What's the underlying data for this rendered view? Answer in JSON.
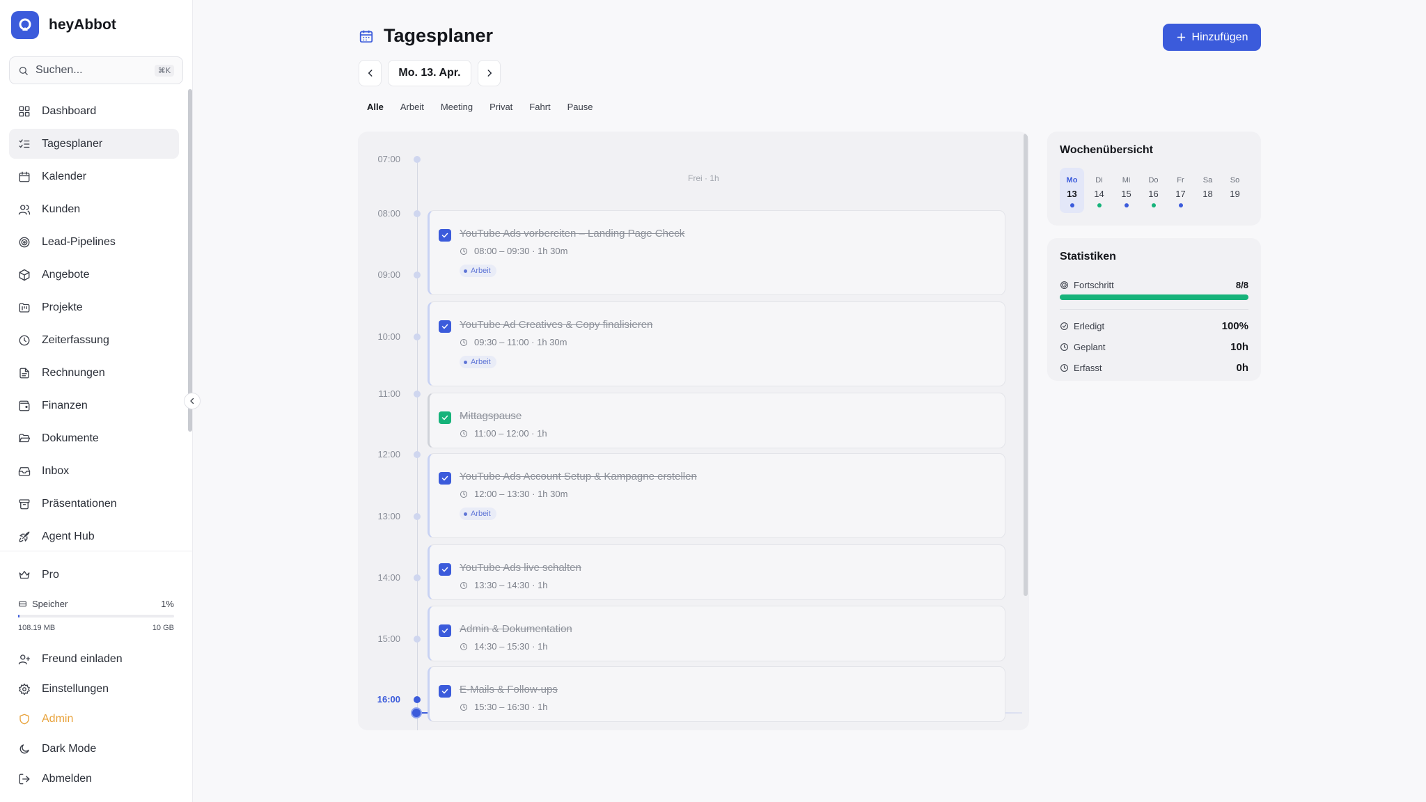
{
  "brand": {
    "name": "heyAbbot"
  },
  "search": {
    "placeholder": "Suchen...",
    "shortcut": "⌘K"
  },
  "nav": [
    {
      "id": "dashboard",
      "label": "Dashboard",
      "icon": "layout-grid-icon"
    },
    {
      "id": "tagesplaner",
      "label": "Tagesplaner",
      "icon": "list-checks-icon",
      "active": true
    },
    {
      "id": "kalender",
      "label": "Kalender",
      "icon": "calendar-icon"
    },
    {
      "id": "kunden",
      "label": "Kunden",
      "icon": "users-icon"
    },
    {
      "id": "lead-pipelines",
      "label": "Lead-Pipelines",
      "icon": "target-icon"
    },
    {
      "id": "angebote",
      "label": "Angebote",
      "icon": "package-icon"
    },
    {
      "id": "projekte",
      "label": "Projekte",
      "icon": "folder-kanban-icon"
    },
    {
      "id": "zeiterfassung",
      "label": "Zeiterfassung",
      "icon": "clock-icon"
    },
    {
      "id": "rechnungen",
      "label": "Rechnungen",
      "icon": "file-text-icon"
    },
    {
      "id": "finanzen",
      "label": "Finanzen",
      "icon": "wallet-icon"
    },
    {
      "id": "dokumente",
      "label": "Dokumente",
      "icon": "folder-open-icon"
    },
    {
      "id": "inbox",
      "label": "Inbox",
      "icon": "inbox-icon"
    },
    {
      "id": "praesentationen",
      "label": "Präsentationen",
      "icon": "archive-icon"
    },
    {
      "id": "agent-hub",
      "label": "Agent Hub",
      "icon": "rocket-icon"
    }
  ],
  "plan": {
    "label": "Pro",
    "icon": "crown-icon"
  },
  "storage": {
    "label": "Speicher",
    "percent_label": "1%",
    "fraction": 0.01,
    "used": "108.19 MB",
    "total": "10 GB"
  },
  "bottom_nav": [
    {
      "id": "freund-einladen",
      "label": "Freund einladen",
      "icon": "user-plus-icon"
    },
    {
      "id": "einstellungen",
      "label": "Einstellungen",
      "icon": "settings-icon"
    },
    {
      "id": "admin",
      "label": "Admin",
      "icon": "shield-icon",
      "accent": "#e8a23a"
    },
    {
      "id": "dark-mode",
      "label": "Dark Mode",
      "icon": "moon-icon"
    },
    {
      "id": "abmelden",
      "label": "Abmelden",
      "icon": "log-out-icon"
    }
  ],
  "header": {
    "title": "Tagesplaner",
    "add_label": "Hinzufügen",
    "date": "Mo. 13. Apr."
  },
  "filters": [
    "Alle",
    "Arbeit",
    "Meeting",
    "Privat",
    "Fahrt",
    "Pause"
  ],
  "active_filter": "Alle",
  "timeline": {
    "hours": [
      "07:00",
      "08:00",
      "09:00",
      "10:00",
      "11:00",
      "12:00",
      "13:00",
      "14:00",
      "15:00",
      "16:00"
    ],
    "current_hour": "16:00",
    "free_label": "Frei · 1h",
    "events": [
      {
        "title": "YouTube Ads vorbereiten – Landing Page Check",
        "time": "08:00 – 09:30 · 1h 30m",
        "tag": "Arbeit",
        "done": true,
        "kind": "work"
      },
      {
        "title": "YouTube Ad Creatives & Copy finalisieren",
        "time": "09:30 – 11:00 · 1h 30m",
        "tag": "Arbeit",
        "done": true,
        "kind": "work"
      },
      {
        "title": "Mittagspause",
        "time": "11:00 – 12:00 · 1h",
        "tag": null,
        "done": true,
        "kind": "pause"
      },
      {
        "title": "YouTube Ads Account Setup & Kampagne erstellen",
        "time": "12:00 – 13:30 · 1h 30m",
        "tag": "Arbeit",
        "done": true,
        "kind": "work"
      },
      {
        "title": "YouTube Ads live schalten",
        "time": "13:30 – 14:30 · 1h",
        "tag": null,
        "done": true,
        "kind": "work"
      },
      {
        "title": "Admin & Dokumentation",
        "time": "14:30 – 15:30 · 1h",
        "tag": null,
        "done": true,
        "kind": "work"
      },
      {
        "title": "E-Mails & Follow-ups",
        "time": "15:30 – 16:30 · 1h",
        "tag": null,
        "done": true,
        "kind": "work"
      }
    ]
  },
  "week": {
    "title": "Wochenübersicht",
    "days": [
      {
        "name": "Mo",
        "num": "13",
        "active": true,
        "dot": "#3b5bdb"
      },
      {
        "name": "Di",
        "num": "14",
        "active": false,
        "dot": "#16b37a"
      },
      {
        "name": "Mi",
        "num": "15",
        "active": false,
        "dot": "#3b5bdb"
      },
      {
        "name": "Do",
        "num": "16",
        "active": false,
        "dot": "#16b37a"
      },
      {
        "name": "Fr",
        "num": "17",
        "active": false,
        "dot": "#3b5bdb"
      },
      {
        "name": "Sa",
        "num": "18",
        "active": false,
        "dot": null
      },
      {
        "name": "So",
        "num": "19",
        "active": false,
        "dot": null
      }
    ]
  },
  "stats": {
    "title": "Statistiken",
    "progress_label": "Fortschritt",
    "progress_value": "8/8",
    "progress_fraction": 1.0,
    "done_label": "Erledigt",
    "done_value": "100%",
    "planned_label": "Geplant",
    "planned_value": "10h",
    "tracked_label": "Erfasst",
    "tracked_value": "0h"
  },
  "colors": {
    "accent": "#3b5bdb",
    "success": "#16b37a",
    "admin": "#e8a23a"
  }
}
